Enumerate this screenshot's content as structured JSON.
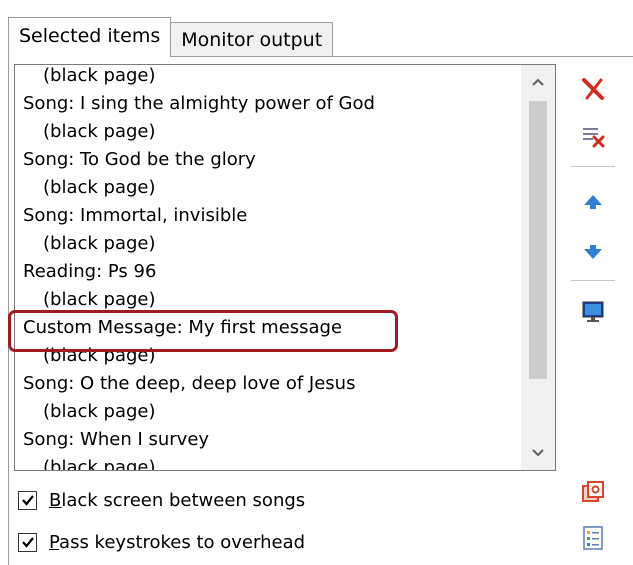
{
  "tabs": [
    {
      "label": "Selected items",
      "active": true
    },
    {
      "label": "Monitor output",
      "active": false
    }
  ],
  "list": {
    "items": [
      {
        "text": "(black page)",
        "indent": true
      },
      {
        "text": "Song: I sing the almighty power of God",
        "indent": false
      },
      {
        "text": "(black page)",
        "indent": true
      },
      {
        "text": "Song: To God be the glory",
        "indent": false
      },
      {
        "text": "(black page)",
        "indent": true
      },
      {
        "text": "Song: Immortal, invisible",
        "indent": false
      },
      {
        "text": "(black page)",
        "indent": true
      },
      {
        "text": "Reading: Ps 96",
        "indent": false
      },
      {
        "text": "(black page)",
        "indent": true
      },
      {
        "text": "Custom Message: My first message",
        "indent": false
      },
      {
        "text": "(black page)",
        "indent": true
      },
      {
        "text": "Song: O the deep, deep love of Jesus",
        "indent": false
      },
      {
        "text": "(black page)",
        "indent": true
      },
      {
        "text": "Song: When I survey",
        "indent": false
      },
      {
        "text": "(black page)",
        "indent": true
      }
    ],
    "highlighted_index": 9
  },
  "toolbar": {
    "icons": [
      "delete-icon",
      "clear-list-icon",
      "move-up-icon",
      "move-down-icon",
      "monitor-icon",
      "presentation-icon",
      "list-properties-icon"
    ],
    "colors": {
      "delete": "#d42a1e",
      "arrow": "#2f7fd6",
      "highlight": "#a31b22"
    }
  },
  "options": {
    "black_screen": {
      "accel": "B",
      "rest": "lack screen between songs",
      "checked": true
    },
    "pass_keystrokes": {
      "accel": "P",
      "rest": "ass keystrokes to overhead",
      "checked": true
    }
  }
}
